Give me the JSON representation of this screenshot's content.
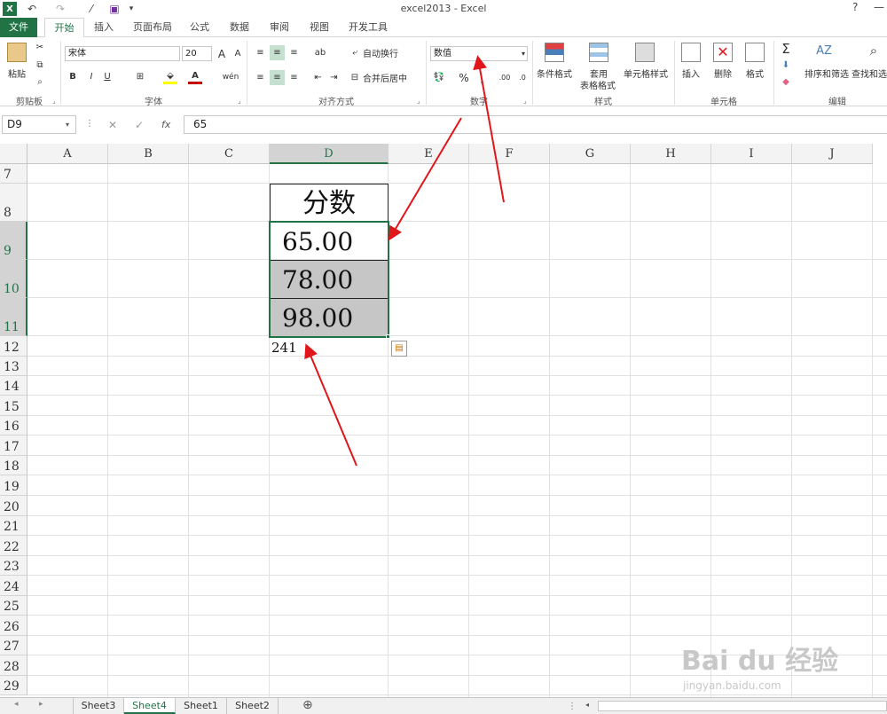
{
  "titlebar": {
    "title": "excel2013 - Excel",
    "help": "?",
    "minimize": "—",
    "close": "✕"
  },
  "tabs": [
    "文件",
    "开始",
    "插入",
    "页面布局",
    "公式",
    "数据",
    "审阅",
    "视图",
    "开发工具"
  ],
  "ribbon": {
    "clipboard": {
      "paste": "粘贴",
      "label": "剪贴板"
    },
    "font": {
      "name": "宋体",
      "size": "20",
      "bold": "B",
      "italic": "I",
      "underline": "U",
      "grow": "A",
      "shrink": "A",
      "label": "字体"
    },
    "alignment": {
      "wrap": "自动换行",
      "merge": "合并后居中",
      "label": "对齐方式"
    },
    "number": {
      "format": "数值",
      "percent": "%",
      "comma": ",",
      "inc_decimal": ".00",
      "label": "数字"
    },
    "styles": {
      "conditional": "条件格式",
      "table_format_1": "套用",
      "table_format_2": "表格格式",
      "cell_styles": "单元格样式",
      "label": "样式"
    },
    "cells": {
      "insert": "插入",
      "delete": "删除",
      "format": "格式",
      "label": "单元格"
    },
    "editing": {
      "sort": "排序和筛选",
      "find": "查找和选",
      "label": "编辑"
    }
  },
  "formula_bar": {
    "name_box": "D9",
    "cancel": "✕",
    "enter": "✓",
    "fx": "fx",
    "value": "65"
  },
  "columns": [
    "A",
    "B",
    "C",
    "D",
    "E",
    "F",
    "G",
    "H",
    "I",
    "J"
  ],
  "rows": [
    "7",
    "8",
    "9",
    "10",
    "11",
    "12",
    "13",
    "14",
    "15",
    "16",
    "17",
    "18",
    "19",
    "20",
    "21",
    "22",
    "23",
    "24",
    "25",
    "26",
    "27",
    "28",
    "29"
  ],
  "cells": {
    "D8": "分数",
    "D9": "65.00",
    "D10": "78.00",
    "D11": "98.00",
    "D12": "241"
  },
  "sheets": [
    "Sheet3",
    "Sheet4",
    "Sheet1",
    "Sheet2"
  ],
  "active_sheet": "Sheet4",
  "add_sheet": "⊕",
  "watermark": {
    "brand": "Bai du 经验",
    "url": "jingyan.baidu.com"
  },
  "colors": {
    "excel_green": "#217346",
    "annotation_red": "#e0161b",
    "selection_gray": "#c6c6c6"
  }
}
